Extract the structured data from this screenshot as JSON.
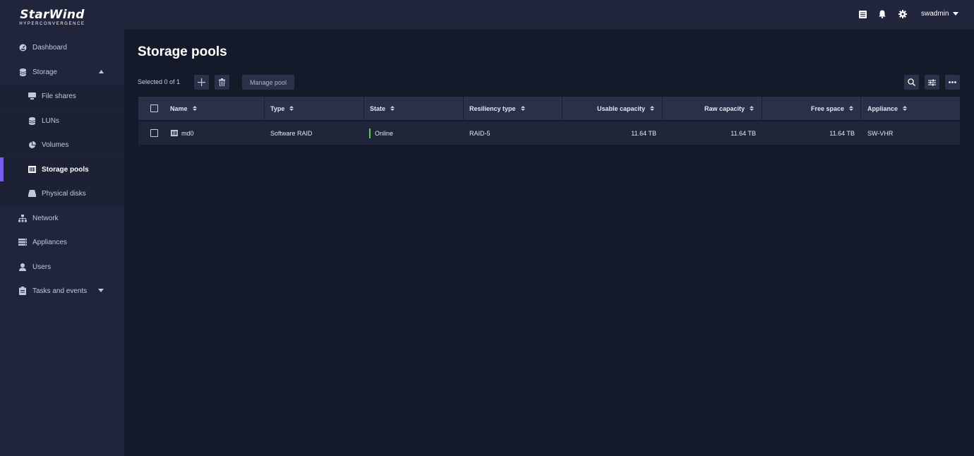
{
  "logo": {
    "main": "StarWind",
    "sub": "HYPERCONVERGENCE"
  },
  "sidebar": {
    "items": [
      {
        "label": "Dashboard",
        "icon": "dashboard-icon"
      },
      {
        "label": "Storage",
        "icon": "storage-icon"
      },
      {
        "label": "File shares",
        "icon": "file-shares-icon"
      },
      {
        "label": "LUNs",
        "icon": "luns-icon"
      },
      {
        "label": "Volumes",
        "icon": "volumes-icon"
      },
      {
        "label": "Storage pools",
        "icon": "storage-pools-icon"
      },
      {
        "label": "Physical disks",
        "icon": "physical-disks-icon"
      },
      {
        "label": "Network",
        "icon": "network-icon"
      },
      {
        "label": "Appliances",
        "icon": "appliances-icon"
      },
      {
        "label": "Users",
        "icon": "users-icon"
      },
      {
        "label": "Tasks and events",
        "icon": "tasks-icon"
      }
    ],
    "active": "Storage pools"
  },
  "topbar": {
    "username": "swadmin"
  },
  "page": {
    "title": "Storage pools"
  },
  "toolbar": {
    "selected_text": "Selected 0 of 1",
    "manage_label": "Manage pool"
  },
  "table": {
    "headers": [
      "Name",
      "Type",
      "State",
      "Resiliency type",
      "Usable capacity",
      "Raw capacity",
      "Free space",
      "Appliance"
    ],
    "rows": [
      {
        "name": "md0",
        "type": "Software RAID",
        "state": "Online",
        "resiliency": "RAID-5",
        "usable": "11.64 TB",
        "raw": "11.64 TB",
        "free": "11.64 TB",
        "appliance": "SW-VHR"
      }
    ]
  },
  "colors": {
    "accent": "#7b5cf0",
    "online": "#5fcf4a",
    "background": "#151a2b",
    "sidebar": "#20253c"
  }
}
